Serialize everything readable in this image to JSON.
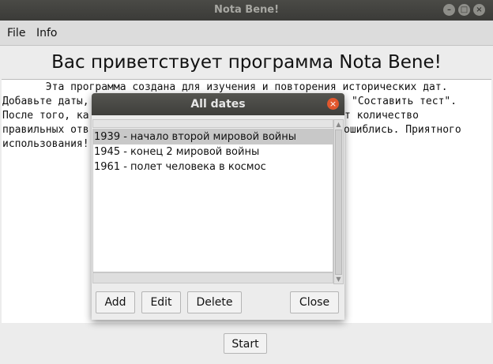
{
  "window": {
    "title": "Nota Bene!",
    "controls": {
      "minimize": "–",
      "maximize": "□",
      "close": "×"
    }
  },
  "menubar": {
    "items": [
      "File",
      "Info"
    ]
  },
  "heading": "Вас приветствует программа Nota Bene!",
  "body_text": [
    "       Эта программа создана для изучения и повторения исторических дат.",
    "Добавьте даты,",
    "После того, ка",
    "правильных отв",
    "использования!"
  ],
  "body_text_right": [
    "\"Составить тест\".",
    "т количество",
    "ошиблись. Приятного"
  ],
  "start_button": "Start",
  "dialog": {
    "title": "All dates",
    "close_glyph": "×",
    "items": [
      "1939 - начало второй мировой войны",
      "1945 - конец 2 мировой войны",
      "1961 - полет человека в космос"
    ],
    "selected_index": 0,
    "buttons": {
      "add": "Add",
      "edit": "Edit",
      "delete": "Delete",
      "close": "Close"
    }
  }
}
